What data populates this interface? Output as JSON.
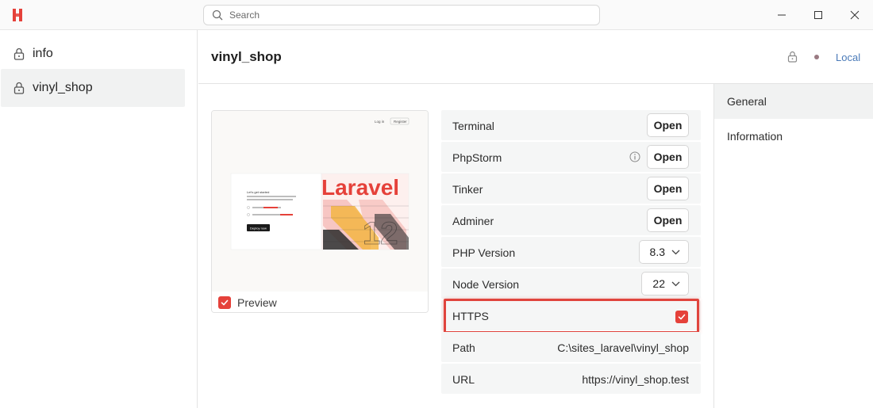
{
  "search": {
    "placeholder": "Search"
  },
  "sidebar": {
    "items": [
      {
        "label": "info",
        "icon": "lock-icon",
        "active": false
      },
      {
        "label": "vinyl_shop",
        "icon": "lock-icon",
        "active": true
      }
    ]
  },
  "header": {
    "title": "vinyl_shop",
    "environment": "Local"
  },
  "preview": {
    "label": "Preview",
    "checked": true,
    "thumbnail": {
      "nav_login": "Log in",
      "nav_register": "Register",
      "heading": "Let's get started",
      "cta": "Deploy now",
      "brand": "Laravel",
      "version": "12"
    }
  },
  "settings": {
    "terminal": {
      "label": "Terminal",
      "action": "Open"
    },
    "phpstorm": {
      "label": "PhpStorm",
      "action": "Open"
    },
    "tinker": {
      "label": "Tinker",
      "action": "Open"
    },
    "adminer": {
      "label": "Adminer",
      "action": "Open"
    },
    "php_version": {
      "label": "PHP Version",
      "value": "8.3"
    },
    "node_version": {
      "label": "Node Version",
      "value": "22"
    },
    "https": {
      "label": "HTTPS",
      "checked": true
    },
    "path": {
      "label": "Path",
      "value": "C:\\sites_laravel\\vinyl_shop"
    },
    "url": {
      "label": "URL",
      "value": "https://vinyl_shop.test"
    }
  },
  "right_panel": {
    "tabs": [
      {
        "label": "General",
        "active": true
      },
      {
        "label": "Information",
        "active": false
      }
    ]
  },
  "colors": {
    "accent_red": "#e5413a",
    "link_blue": "#4a7ab8",
    "row_bg": "#f5f6f6"
  }
}
